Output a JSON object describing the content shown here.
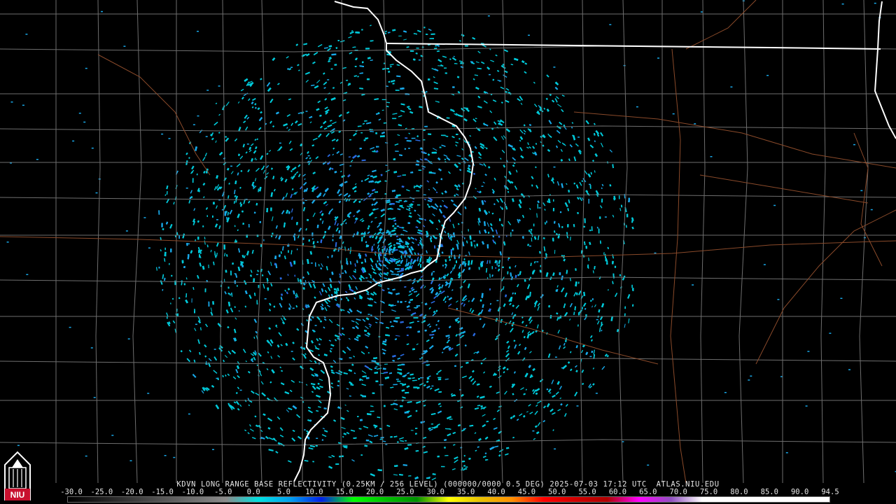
{
  "header": {
    "site": "KDVN",
    "product": "LONG RANGE BASE REFLECTIVITY",
    "resolution": "(0.25KM / 256 LEVEL)",
    "vcp": "(000000/0000 0.5 DEG)",
    "timestamp": "2025-07-03 17:12 UTC",
    "source": "ATLAS.NIU.EDU"
  },
  "logo": {
    "text": "NIU",
    "icon": "university-tower-icon",
    "color": "#c8102e"
  },
  "map": {
    "radar_site": "KDVN",
    "state_border_color": "#ffffff",
    "county_line_color": "#6e6e6e",
    "highway_color": "#8a4a2a",
    "echo_colors": [
      "#00c8d8",
      "#18a8e8",
      "#2a6ae0",
      "#00e070"
    ]
  },
  "color_scale": {
    "labels": [
      "-30.0",
      "-25.0",
      "-20.0",
      "-15.0",
      "-10.0",
      "-5.0",
      "0.0",
      "5.0",
      "10.0",
      "15.0",
      "20.0",
      "25.0",
      "30.0",
      "35.0",
      "40.0",
      "45.0",
      "50.0",
      "55.0",
      "60.0",
      "65.0",
      "70.0",
      "75.0",
      "80.0",
      "85.0",
      "90.0",
      "94.5"
    ],
    "colors": [
      "#000000",
      "#1c1c1c",
      "#383838",
      "#555555",
      "#707070",
      "#8c8c8c",
      "#00e0e0",
      "#00a0f0",
      "#0020e8",
      "#00ff00",
      "#00c000",
      "#009000",
      "#ffff00",
      "#e8c000",
      "#ff9000",
      "#ff0000",
      "#d00000",
      "#b00000",
      "#ff00ff",
      "#9050c0",
      "#ffffff",
      "#ffffff",
      "#ffffff",
      "#ffffff",
      "#ffffff"
    ]
  }
}
